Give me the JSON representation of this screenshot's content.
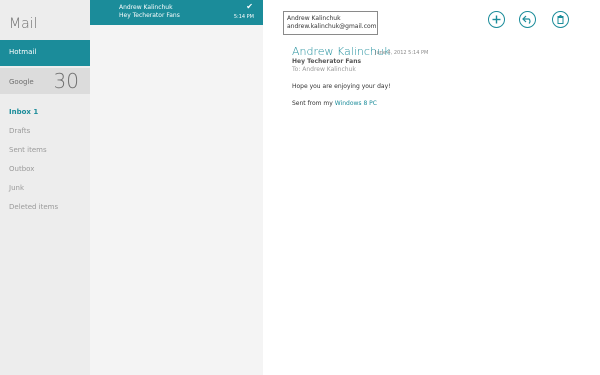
{
  "app": {
    "title": "Mail"
  },
  "accounts": [
    {
      "name": "Hotmail",
      "count": ""
    },
    {
      "name": "Google",
      "count": "30"
    }
  ],
  "folders": [
    {
      "label": "Inbox 1",
      "selected": true
    },
    {
      "label": "Drafts"
    },
    {
      "label": "Sent items"
    },
    {
      "label": "Outbox"
    },
    {
      "label": "Junk"
    },
    {
      "label": "Deleted items"
    }
  ],
  "message_list": [
    {
      "sender": "Andrew Kalinchuk",
      "subject": "Hey Techerator Fans",
      "time": "5:14 PM",
      "checked": true
    }
  ],
  "contact_card": {
    "name": "Andrew Kalinchuk",
    "email": "andrew.kalinchuk@gmail.com"
  },
  "commands": [
    {
      "name": "new-message",
      "icon": "plus-icon"
    },
    {
      "name": "respond",
      "icon": "reply-icon"
    },
    {
      "name": "delete",
      "icon": "trash-icon"
    }
  ],
  "message": {
    "sender": "Andrew Kalinchuk",
    "date": "June 4, 2012   5:14 PM",
    "subject": "Hey Techerator Fans",
    "to": "To: Andrew Kalinchuk",
    "body": "Hope you are enjoying your day!",
    "signature_prefix": "Sent from my ",
    "signature_link": "Windows 8 PC"
  },
  "colors": {
    "accent": "#1b8c9a",
    "nav_bg": "#ededed",
    "list_bg": "#f4f4f4"
  }
}
